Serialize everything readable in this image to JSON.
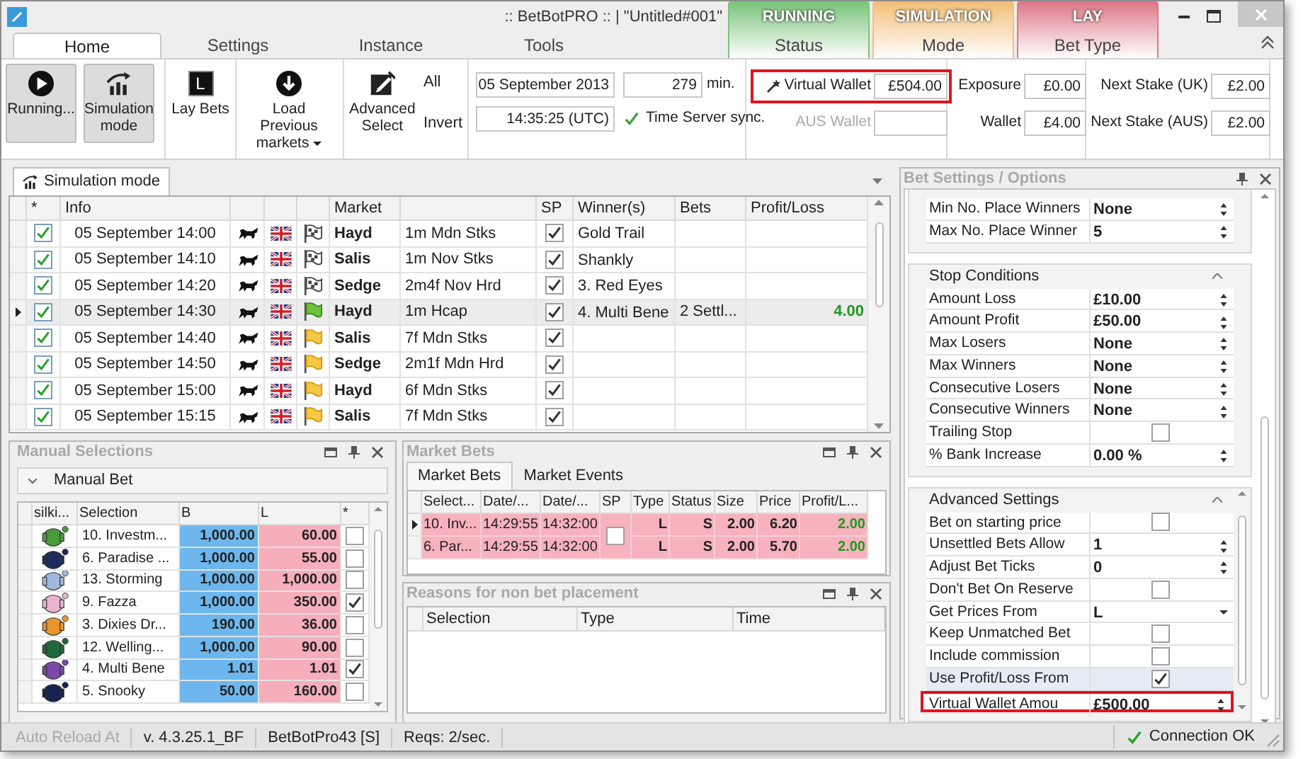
{
  "window": {
    "title": ":: BetBotPRO :: | \"Untitled#001\""
  },
  "ribbon_tabs": [
    {
      "label": "Home",
      "selected": true
    },
    {
      "label": "Settings",
      "selected": false
    },
    {
      "label": "Instance",
      "selected": false
    },
    {
      "label": "Tools",
      "selected": false
    }
  ],
  "indicators": [
    {
      "value": "RUNNING",
      "label": "Status",
      "color": "#7cc47c"
    },
    {
      "value": "SIMULATION",
      "label": "Mode",
      "color": "#f3c07a"
    },
    {
      "value": "LAY",
      "label": "Bet Type",
      "color": "#de7a88"
    }
  ],
  "ribbon": {
    "buttons": [
      {
        "kind": "play",
        "label": "Running...",
        "selected": true
      },
      {
        "kind": "chart",
        "label": "Simulation mode",
        "selected": true
      },
      {
        "kind": "letter",
        "glyph": "L",
        "label": "Lay Bets",
        "selected": false
      },
      {
        "kind": "download",
        "label": "Load Previous markets",
        "selected": false,
        "dropdown": true
      },
      {
        "kind": "edit",
        "label": "Advanced Select",
        "selected": false
      }
    ],
    "select_links": [
      "All",
      "Invert"
    ],
    "date": "05 September 2013",
    "time": "14:35:25 (UTC)",
    "minutes": "279",
    "minutes_unit": "min.",
    "time_sync": "Time Server sync.",
    "field_groups": [
      {
        "highlighted_first": true,
        "fields": [
          {
            "label": "Virtual Wallet",
            "value": "£504.00",
            "disabled": false
          },
          {
            "label": "AUS Wallet",
            "disabled": true
          }
        ]
      },
      {
        "highlighted_first": false,
        "fields": [
          {
            "label": "Exposure",
            "value": "£0.00",
            "disabled": false
          },
          {
            "label": "Wallet",
            "value": "£4.00",
            "disabled": false
          }
        ]
      },
      {
        "highlighted_first": false,
        "fields": [
          {
            "label": "Next Stake (UK)",
            "value": "£2.00",
            "disabled": false
          },
          {
            "label": "Next Stake (AUS)",
            "value": "£2.00",
            "disabled": false
          }
        ]
      }
    ]
  },
  "document_tab": {
    "label": "Simulation mode"
  },
  "markets": {
    "columns": [
      "*",
      "Info",
      "Market",
      "SP",
      "Winner(s)",
      "Bets",
      "Profit/Loss"
    ],
    "rows": [
      {
        "checked": true,
        "time": "05 September 14:00",
        "kind": "chequered",
        "course": "Hayd",
        "race": "1m Mdn Stks",
        "sp": true,
        "winner": "Gold Trail",
        "selected": false
      },
      {
        "checked": true,
        "time": "05 September 14:10",
        "kind": "chequered",
        "course": "Salis",
        "race": "1m Nov Stks",
        "sp": true,
        "winner": "Shankly",
        "selected": false
      },
      {
        "checked": true,
        "time": "05 September 14:20",
        "kind": "chequered",
        "course": "Sedge",
        "race": "2m4f Nov Hrd",
        "sp": true,
        "winner": "3. Red Eyes",
        "selected": false
      },
      {
        "checked": true,
        "time": "05 September 14:30",
        "kind": "green",
        "course": "Hayd",
        "race": "1m Hcap",
        "sp": true,
        "winner": "4. Multi Bene",
        "bets": "2 Settl...",
        "profit": "4.00",
        "selected": true
      },
      {
        "checked": true,
        "time": "05 September 14:40",
        "kind": "yellow",
        "course": "Salis",
        "race": "7f Mdn Stks",
        "sp": true,
        "selected": false
      },
      {
        "checked": true,
        "time": "05 September 14:50",
        "kind": "yellow",
        "course": "Sedge",
        "race": "2m1f Mdn Hrd",
        "sp": true,
        "selected": false
      },
      {
        "checked": true,
        "time": "05 September 15:00",
        "kind": "yellow",
        "course": "Hayd",
        "race": "6f Mdn Stks",
        "sp": true,
        "selected": false
      },
      {
        "checked": true,
        "time": "05 September 15:15",
        "kind": "yellow",
        "course": "Salis",
        "race": "7f Mdn Stks",
        "sp": true,
        "selected": false
      }
    ]
  },
  "manual_selections": {
    "title": "Manual Selections",
    "group": "Manual Bet",
    "columns": [
      "silki...",
      "Selection",
      "B",
      "L",
      "*"
    ],
    "rows": [
      {
        "color": "#4a9a3a",
        "selection": "10. Investm...",
        "back": "1,000.00",
        "lay": "60.00",
        "checked": false
      },
      {
        "color": "#1f2a5c",
        "selection": "6. Paradise ...",
        "back": "1,000.00",
        "lay": "55.00",
        "checked": false
      },
      {
        "color": "#9fb8dc",
        "selection": "13. Storming",
        "back": "1,000.00",
        "lay": "1,000.00",
        "checked": false
      },
      {
        "color": "#e8b4d0",
        "selection": "9. Fazza",
        "back": "1,000.00",
        "lay": "350.00",
        "checked": true
      },
      {
        "color": "#e8962a",
        "selection": "3. Dixies Dr...",
        "back": "190.00",
        "lay": "36.00",
        "checked": false
      },
      {
        "color": "#1f6a3a",
        "selection": "12. Welling...",
        "back": "1,000.00",
        "lay": "90.00",
        "checked": false
      },
      {
        "color": "#7a4aa8",
        "selection": "4. Multi Bene",
        "back": "1.01",
        "lay": "1.01",
        "checked": true
      },
      {
        "color": "#16244e",
        "selection": "5. Snooky",
        "back": "50.00",
        "lay": "160.00",
        "checked": false
      }
    ]
  },
  "market_bets": {
    "title": "Market Bets",
    "tabs": [
      {
        "label": "Market Bets",
        "selected": true
      },
      {
        "label": "Market Events",
        "selected": false
      }
    ],
    "columns": [
      "Select...",
      "Date/...",
      "Date/...",
      "SP",
      "Type",
      "Status",
      "Size",
      "Price",
      "Profit/L..."
    ],
    "sp_checked": false,
    "rows": [
      {
        "selection": "10. Inv...",
        "placed": "14:29:55",
        "matched": "14:32:00",
        "type": "L",
        "status": "S",
        "size": "2.00",
        "price": "6.20",
        "profit": "2.00",
        "selected": true
      },
      {
        "selection": "6. Par...",
        "placed": "14:29:55",
        "matched": "14:32:00",
        "type": "L",
        "status": "S",
        "size": "2.00",
        "price": "5.70",
        "profit": "2.00",
        "selected": false
      }
    ]
  },
  "reasons": {
    "title": "Reasons for non bet placement",
    "columns": [
      "Selection",
      "Type",
      "Time"
    ]
  },
  "bet_settings": {
    "title": "Bet Settings / Options",
    "sections": [
      {
        "rows": [
          {
            "label": "Min No. Place Winners",
            "kind": "spin",
            "value": "None"
          },
          {
            "label": "Max No. Place Winner",
            "kind": "spin",
            "value": "5"
          }
        ]
      },
      {
        "title": "Stop Conditions",
        "expanded": true,
        "rows": [
          {
            "label": "Amount Loss",
            "kind": "spin",
            "value": "£10.00"
          },
          {
            "label": "Amount Profit",
            "kind": "spin",
            "value": "£50.00"
          },
          {
            "label": "Max Losers",
            "kind": "spin",
            "value": "None"
          },
          {
            "label": "Max Winners",
            "kind": "spin",
            "value": "None"
          },
          {
            "label": "Consecutive Losers",
            "kind": "spin",
            "value": "None"
          },
          {
            "label": "Consecutive Winners",
            "kind": "spin",
            "value": "None"
          },
          {
            "label": "Trailing Stop",
            "kind": "check",
            "checked": false
          },
          {
            "label": "% Bank Increase",
            "kind": "spin",
            "value": "0.00 %"
          }
        ]
      },
      {
        "title": "Advanced Settings",
        "expanded": true,
        "rows": [
          {
            "label": "Bet on starting price",
            "kind": "check",
            "checked": false,
            "selected": false,
            "highlighted": false
          },
          {
            "label": "Unsettled Bets Allow",
            "kind": "spin",
            "value": "1",
            "selected": false,
            "highlighted": false
          },
          {
            "label": "Adjust Bet Ticks",
            "kind": "spin",
            "value": "0",
            "selected": false,
            "highlighted": false
          },
          {
            "label": "Don't Bet On Reserve",
            "kind": "check",
            "checked": false,
            "selected": false,
            "highlighted": false
          },
          {
            "label": "Get Prices From",
            "kind": "dropdown",
            "value": "L",
            "selected": false,
            "highlighted": false
          },
          {
            "label": "Keep Unmatched Bet",
            "kind": "check",
            "checked": false,
            "selected": false,
            "highlighted": false
          },
          {
            "label": "Include commission",
            "kind": "check",
            "checked": false,
            "selected": false,
            "highlighted": false
          },
          {
            "label": "Use Profit/Loss From",
            "kind": "check",
            "checked": true,
            "selected": true,
            "highlighted": false
          },
          {
            "label": "Virtual Wallet Amou",
            "kind": "spin",
            "value": "£500.00",
            "selected": false,
            "highlighted": true
          }
        ]
      }
    ]
  },
  "status_bar": {
    "items": [
      {
        "text": "Auto Reload At",
        "disabled": true
      },
      {
        "text": "v. 4.3.25.1_BF",
        "disabled": false
      },
      {
        "text": "BetBotPro43 [S]",
        "disabled": false
      },
      {
        "text": "Reqs: 2/sec.",
        "disabled": false
      }
    ],
    "connection": "Connection OK"
  }
}
